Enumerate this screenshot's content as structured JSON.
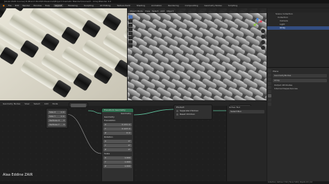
{
  "window": {
    "title": "[ALAA ZAIR Course] D:\\Brand Work\\Professional\\Project Cosmetic Blender\\Course\\3 - Array\\Blender 4.0"
  },
  "menubar": {
    "items": [
      "File",
      "Edit",
      "Render",
      "Window",
      "Help"
    ],
    "workspaces": [
      "Layout",
      "Modeling",
      "Sculpting",
      "UV Editing",
      "Texture Paint",
      "Shading",
      "Animation",
      "Rendering",
      "Compositing",
      "Geometry Nodes",
      "Scripting"
    ],
    "active_workspace": "Layout"
  },
  "viewport": {
    "toolbar": [
      "Object Mode",
      "View",
      "Select",
      "Add",
      "Object"
    ],
    "tools": [
      "select-tool",
      "cursor-tool",
      "move-tool",
      "rotate-tool",
      "scale-tool",
      "transform-tool",
      "annotate-tool",
      "measure-tool"
    ]
  },
  "outliner": {
    "rows": [
      {
        "label": "Scene Collection",
        "selected": false
      },
      {
        "label": "Collection",
        "selected": false
      },
      {
        "label": "Camera",
        "selected": false
      },
      {
        "label": "Light",
        "selected": false
      },
      {
        "label": "Array",
        "selected": true
      }
    ]
  },
  "properties": {
    "panel_rows": [
      "Plane",
      "GeometryNodes",
      "Array",
      "Output Attributes",
      "Internal Dependencies"
    ]
  },
  "node_editor": {
    "header": [
      "Geometry Nodes",
      "View",
      "Select",
      "Add",
      "Node"
    ],
    "group_input": {
      "fields": [
        {
          "label": "Size X",
          "value": "1 m",
          "color": "#a1a1a1"
        },
        {
          "label": "Size Y",
          "value": "1 m",
          "color": "#a1a1a1"
        },
        {
          "label": "Vertices X",
          "value": "3",
          "color": "#598c5c"
        },
        {
          "label": "Vertices Y",
          "value": "3",
          "color": "#598c5c"
        }
      ],
      "value_node": "1.01 m"
    },
    "transform_node": {
      "title": "Transform Geometry",
      "header_color": "#2f6d4f",
      "output": "Geometry",
      "rows": [
        {
          "type": "label",
          "text": "Geometry"
        },
        {
          "type": "label",
          "text": "Translation"
        },
        {
          "type": "field",
          "label": "X",
          "value": "0.131 m"
        },
        {
          "type": "field",
          "label": "Y",
          "value": "0.123 m"
        },
        {
          "type": "field",
          "label": "Z",
          "value": "0 m"
        },
        {
          "type": "label",
          "text": "Rotation"
        },
        {
          "type": "field",
          "label": "X",
          "value": "0°"
        },
        {
          "type": "field",
          "label": "Y",
          "value": "0°"
        },
        {
          "type": "field",
          "label": "Z",
          "value": "0°"
        },
        {
          "type": "label",
          "text": "Scale"
        },
        {
          "type": "field",
          "label": "X",
          "value": "1.000"
        },
        {
          "type": "field",
          "label": "Y",
          "value": "1.000"
        },
        {
          "type": "field",
          "label": "Z",
          "value": "1.000"
        }
      ]
    },
    "realize_node": {
      "rows": [
        "Product",
        "Separate Children",
        "Reset Children"
      ]
    },
    "group_output": {
      "title": "Group Output",
      "rows": [
        "Geometry"
      ]
    }
  },
  "sidebar_node": {
    "rows": [
      "Active Tool",
      "Select Box"
    ]
  },
  "credit": "Alaa Eddine ZAIR",
  "statusbar": "Collection | Vertices 7,712 | Faces 7,616 | Objects 1/3 | 4.0"
}
